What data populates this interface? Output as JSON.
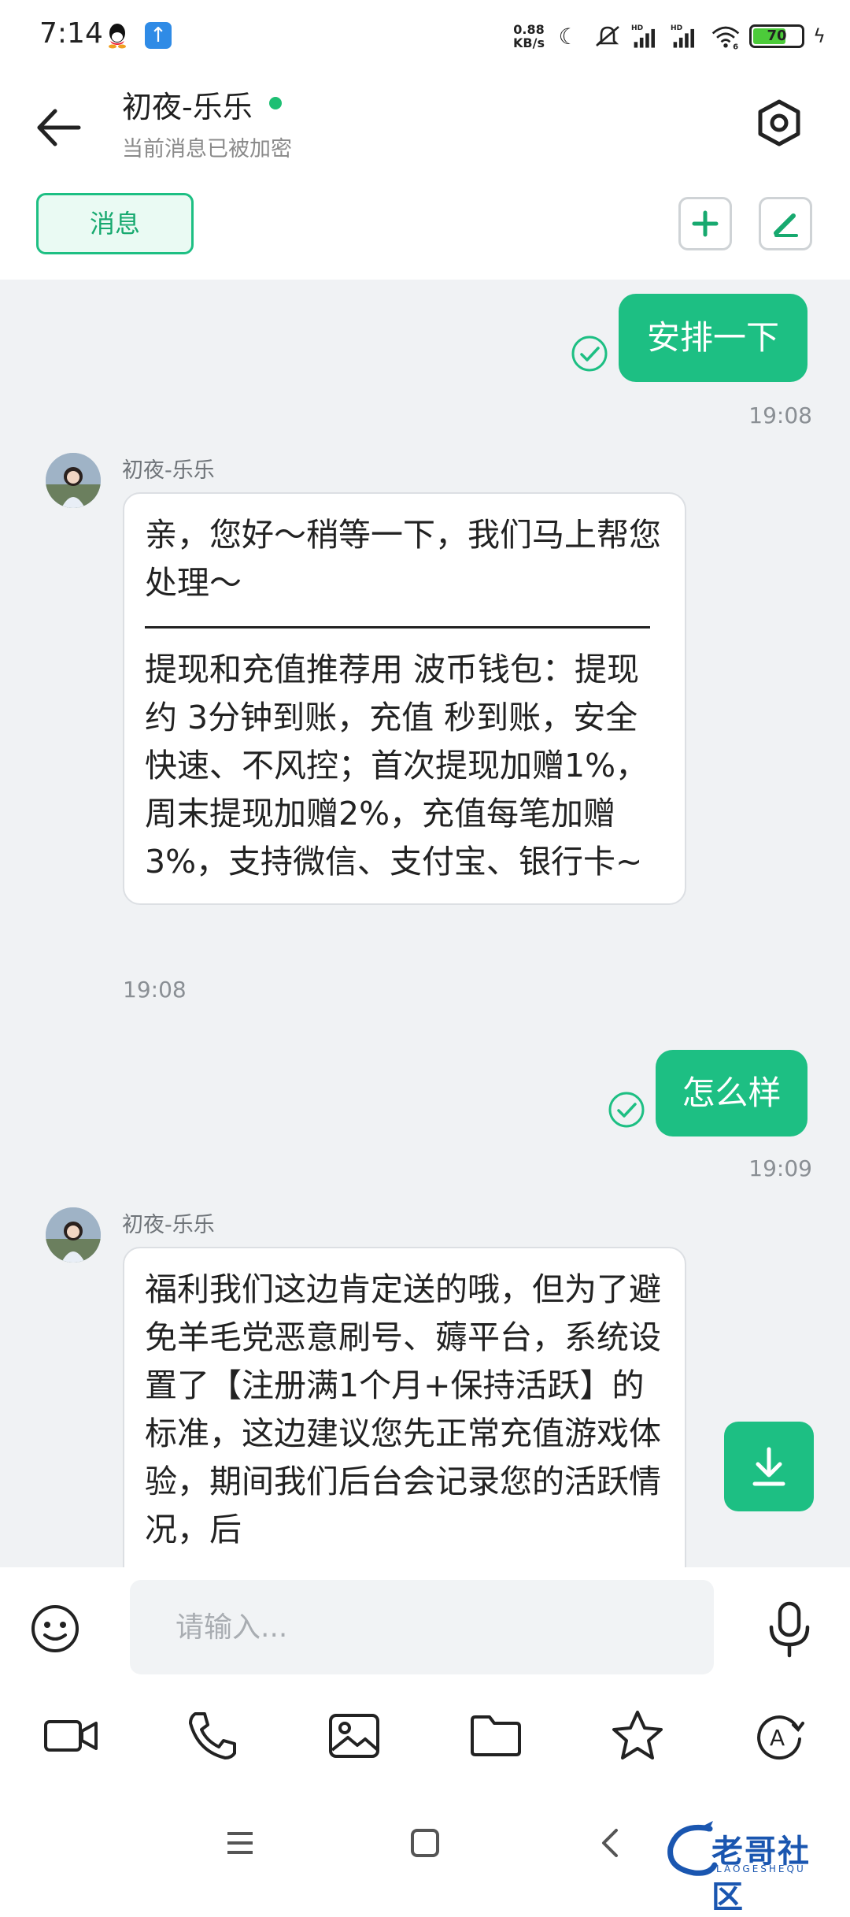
{
  "status_bar": {
    "time": "7:14",
    "net_speed_value": "0.88",
    "net_speed_unit": "KB/s",
    "battery_level": 70,
    "battery_label": "70",
    "icons": [
      "qq-icon",
      "upload-icon",
      "moon-icon",
      "mute-icon",
      "signal-hd-icon",
      "signal-hd-icon",
      "wifi-6-icon",
      "battery-icon",
      "charging-icon"
    ]
  },
  "header": {
    "title": "初夜-乐乐",
    "subtitle": "当前消息已被加密",
    "online": true,
    "tab_label": "消息"
  },
  "messages": [
    {
      "direction": "out",
      "text": "安排一下",
      "time": "19:08",
      "status": "read"
    },
    {
      "direction": "in",
      "sender": "初夜-乐乐",
      "text": "亲，您好～稍等一下，我们马上帮您处理～",
      "text_after_divider": "提现和充值推荐用 波币钱包：提现约 3分钟到账，充值 秒到账，安全快速、不风控；首次提现加赠1%，周末提现加赠2%，充值每笔加赠3%，支持微信、支付宝、银行卡~",
      "time": "19:08"
    },
    {
      "direction": "out",
      "text": "怎么样",
      "time": "19:09",
      "status": "read"
    },
    {
      "direction": "in",
      "sender": "初夜-乐乐",
      "text": "福利我们这边肯定送的哦，但为了避免羊毛党恶意刷号、薅平台，系统设置了【注册满1个月+保持活跃】的标准，这边建议您先正常充值游戏体验，期间我们后台会记录您的活跃情况，后"
    }
  ],
  "input": {
    "placeholder": "请输入..."
  },
  "toolbar": [
    "video-icon",
    "phone-icon",
    "image-icon",
    "folder-icon",
    "star-icon",
    "auto-translate-icon"
  ],
  "watermark": {
    "text": "老哥社区",
    "sub": "LAOGESHEQU"
  },
  "colors": {
    "accent": "#1dbf83",
    "chat_bg": "#f0f2f4",
    "bubble_in_border": "#dcdfe3"
  }
}
